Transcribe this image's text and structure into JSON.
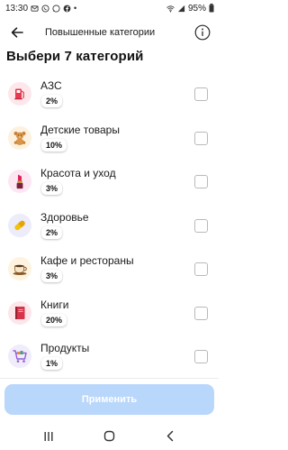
{
  "status_bar": {
    "time": "13:30",
    "battery": "95%"
  },
  "header": {
    "title": "Повышенные категории"
  },
  "page": {
    "title": "Выбери 7 категорий"
  },
  "categories": [
    {
      "name": "АЗС",
      "percent": "2%",
      "icon": "gas-pump-icon",
      "bg": "#fde7ea"
    },
    {
      "name": "Детские товары",
      "percent": "10%",
      "icon": "teddy-bear-icon",
      "bg": "#fdf1df"
    },
    {
      "name": "Красота и уход",
      "percent": "3%",
      "icon": "lipstick-icon",
      "bg": "#fbe6f2"
    },
    {
      "name": "Здоровье",
      "percent": "2%",
      "icon": "pill-icon",
      "bg": "#ececfb"
    },
    {
      "name": "Кафе и рестораны",
      "percent": "3%",
      "icon": "coffee-cup-icon",
      "bg": "#fdf3df"
    },
    {
      "name": "Книги",
      "percent": "20%",
      "icon": "book-icon",
      "bg": "#fde6ea"
    },
    {
      "name": "Продукты",
      "percent": "1%",
      "icon": "shopping-cart-icon",
      "bg": "#f0ecfb"
    }
  ],
  "apply_button": {
    "label": "Применить"
  },
  "colors": {
    "accent_disabled": "#b9d7fb",
    "checkbox_border": "#b9b9bd"
  }
}
